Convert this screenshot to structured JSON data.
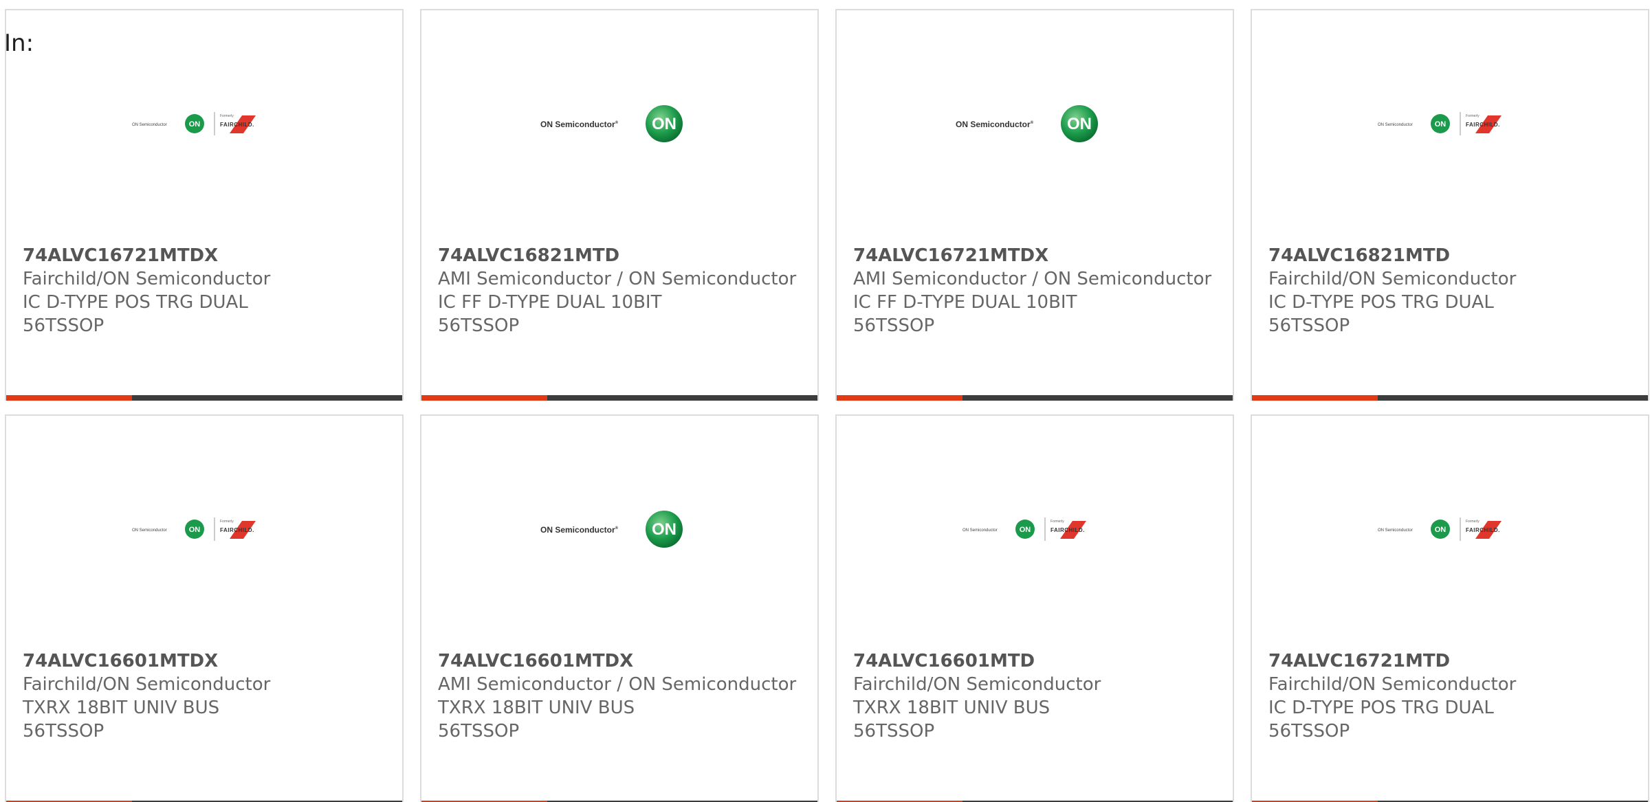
{
  "filter_label": "In:",
  "colors": {
    "accent": "#e23a14",
    "bar": "#3c3c3c",
    "on_green": "#1a9a4a",
    "fairchild_red": "#e0362c"
  },
  "products": [
    {
      "part_number": "74ALVC16721MTDX",
      "manufacturer": "Fairchild/ON Semiconductor",
      "description": "IC D-TYPE POS TRG DUAL 56TSSOP",
      "logo": "on-fairchild-logo",
      "logo_text": {
        "on": "ON Semiconductor",
        "formerly": "Formerly",
        "fairchild": "FAIRCHILD."
      }
    },
    {
      "part_number": "74ALVC16821MTD",
      "manufacturer": "AMI Semiconductor / ON Semiconductor",
      "description": "IC FF D-TYPE DUAL 10BIT 56TSSOP",
      "logo": "on-semiconductor-logo",
      "logo_text": {
        "on": "ON Semiconductor"
      }
    },
    {
      "part_number": "74ALVC16721MTDX",
      "manufacturer": "AMI Semiconductor / ON Semiconductor",
      "description": "IC FF D-TYPE DUAL 10BIT 56TSSOP",
      "logo": "on-semiconductor-logo",
      "logo_text": {
        "on": "ON Semiconductor"
      }
    },
    {
      "part_number": "74ALVC16821MTD",
      "manufacturer": "Fairchild/ON Semiconductor",
      "description": "IC D-TYPE POS TRG DUAL 56TSSOP",
      "logo": "on-fairchild-logo",
      "logo_text": {
        "on": "ON Semiconductor",
        "formerly": "Formerly",
        "fairchild": "FAIRCHILD."
      }
    },
    {
      "part_number": "74ALVC16601MTDX",
      "manufacturer": "Fairchild/ON Semiconductor",
      "description": "TXRX 18BIT UNIV BUS 56TSSOP",
      "logo": "on-fairchild-logo",
      "logo_text": {
        "on": "ON Semiconductor",
        "formerly": "Formerly",
        "fairchild": "FAIRCHILD."
      }
    },
    {
      "part_number": "74ALVC16601MTDX",
      "manufacturer": "AMI Semiconductor / ON Semiconductor",
      "description": "TXRX 18BIT UNIV BUS 56TSSOP",
      "logo": "on-semiconductor-logo",
      "logo_text": {
        "on": "ON Semiconductor"
      }
    },
    {
      "part_number": "74ALVC16601MTD",
      "manufacturer": "Fairchild/ON Semiconductor",
      "description": "TXRX 18BIT UNIV BUS 56TSSOP",
      "logo": "on-fairchild-logo",
      "logo_text": {
        "on": "ON Semiconductor",
        "formerly": "Formerly",
        "fairchild": "FAIRCHILD."
      }
    },
    {
      "part_number": "74ALVC16721MTD",
      "manufacturer": "Fairchild/ON Semiconductor",
      "description": "IC D-TYPE POS TRG DUAL 56TSSOP",
      "logo": "on-fairchild-logo",
      "logo_text": {
        "on": "ON Semiconductor",
        "formerly": "Formerly",
        "fairchild": "FAIRCHILD."
      }
    }
  ]
}
